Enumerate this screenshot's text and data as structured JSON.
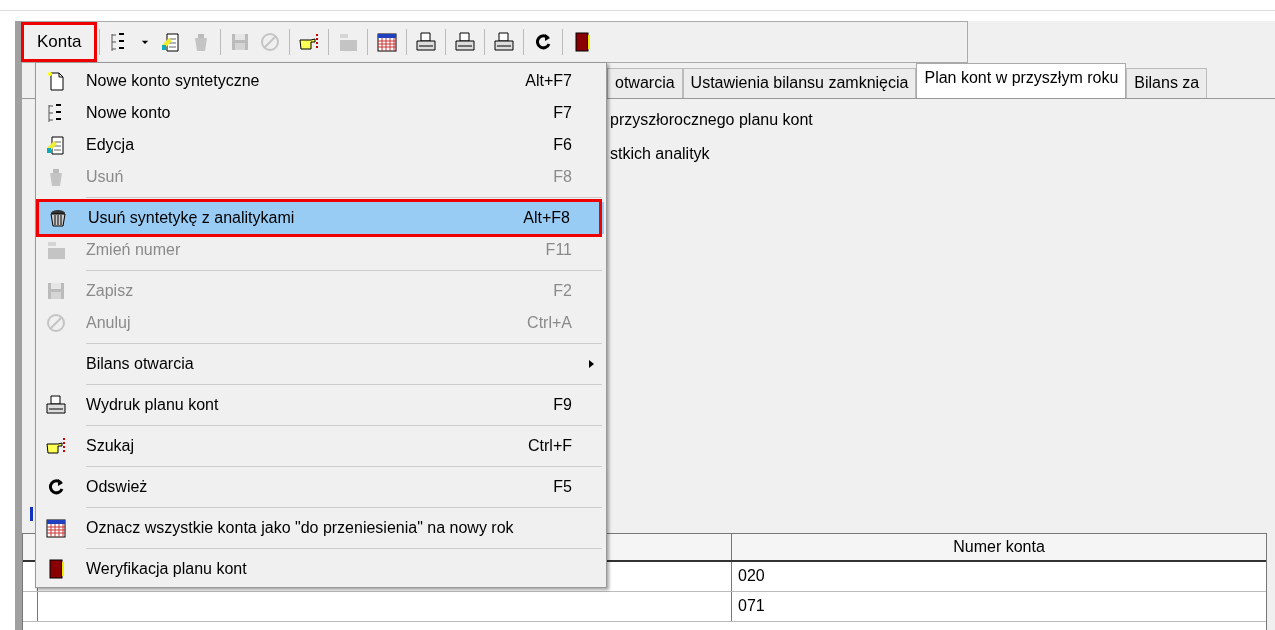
{
  "toolbar": {
    "menu_button": {
      "label": "Konta",
      "annotated": true
    },
    "items": [
      {
        "kind": "numbered-list",
        "disabled": false
      },
      {
        "kind": "dropdown",
        "disabled": false
      },
      {
        "kind": "edit",
        "disabled": false
      },
      {
        "kind": "trash",
        "disabled": true
      },
      {
        "kind": "separator"
      },
      {
        "kind": "save",
        "disabled": true
      },
      {
        "kind": "cancel",
        "disabled": true
      },
      {
        "kind": "separator"
      },
      {
        "kind": "search",
        "disabled": false
      },
      {
        "kind": "separator"
      },
      {
        "kind": "renumber",
        "disabled": true
      },
      {
        "kind": "separator"
      },
      {
        "kind": "calendar",
        "disabled": false
      },
      {
        "kind": "separator"
      },
      {
        "kind": "printer",
        "disabled": false
      },
      {
        "kind": "separator"
      },
      {
        "kind": "printer",
        "disabled": false
      },
      {
        "kind": "separator"
      },
      {
        "kind": "printer",
        "disabled": false
      },
      {
        "kind": "separator"
      },
      {
        "kind": "refresh",
        "disabled": false
      },
      {
        "kind": "separator"
      },
      {
        "kind": "exit",
        "disabled": false
      }
    ]
  },
  "tabs": [
    {
      "label": "otwarcia",
      "selected": false
    },
    {
      "label": "Ustawienia bilansu zamknięcia",
      "selected": false
    },
    {
      "label": "Plan kont w przyszłym roku",
      "selected": true
    },
    {
      "label": "Bilans za",
      "selected": false
    }
  ],
  "options": [
    "przyszłorocznego planu kont",
    "stkich analityk"
  ],
  "grid": {
    "columns": [
      "Numer konta"
    ],
    "rows": [
      [
        "020"
      ],
      [
        "071"
      ]
    ]
  },
  "menu": {
    "items": [
      {
        "kind": "item",
        "label": "Nowe konto syntetyczne",
        "shortcut": "Alt+F7",
        "disabled": false,
        "selected": false
      },
      {
        "kind": "item",
        "label": "Nowe konto",
        "shortcut": "F7",
        "disabled": false,
        "selected": false
      },
      {
        "kind": "item",
        "label": "Edycja",
        "shortcut": "F6",
        "disabled": false,
        "selected": false
      },
      {
        "kind": "item",
        "label": "Usuń",
        "shortcut": "F8",
        "disabled": true,
        "selected": false
      },
      {
        "kind": "separator"
      },
      {
        "kind": "item",
        "label": "Usuń syntetykę z analitykami",
        "shortcut": "Alt+F8",
        "disabled": false,
        "selected": true,
        "annotated": true
      },
      {
        "kind": "item",
        "label": "Zmień numer",
        "shortcut": "F11",
        "disabled": true,
        "selected": false
      },
      {
        "kind": "separator"
      },
      {
        "kind": "item",
        "label": "Zapisz",
        "shortcut": "F2",
        "disabled": true,
        "selected": false
      },
      {
        "kind": "item",
        "label": "Anuluj",
        "shortcut": "Ctrl+A",
        "disabled": true,
        "selected": false
      },
      {
        "kind": "separator"
      },
      {
        "kind": "item",
        "label": "Bilans otwarcia",
        "disabled": false,
        "selected": false,
        "submenu": true
      },
      {
        "kind": "separator"
      },
      {
        "kind": "item",
        "label": "Wydruk planu kont",
        "shortcut": "F9",
        "disabled": false,
        "selected": false
      },
      {
        "kind": "separator"
      },
      {
        "kind": "item",
        "label": "Szukaj",
        "shortcut": "Ctrl+F",
        "disabled": false,
        "selected": false
      },
      {
        "kind": "separator"
      },
      {
        "kind": "item",
        "label": "Odswież",
        "shortcut": "F5",
        "disabled": false,
        "selected": false
      },
      {
        "kind": "separator"
      },
      {
        "kind": "item",
        "label": "Oznacz wszystkie konta jako \"do przeniesienia\" na nowy rok",
        "disabled": false,
        "selected": false
      },
      {
        "kind": "separator"
      },
      {
        "kind": "item",
        "label": "Weryfikacja planu kont",
        "disabled": false,
        "selected": false
      }
    ]
  }
}
